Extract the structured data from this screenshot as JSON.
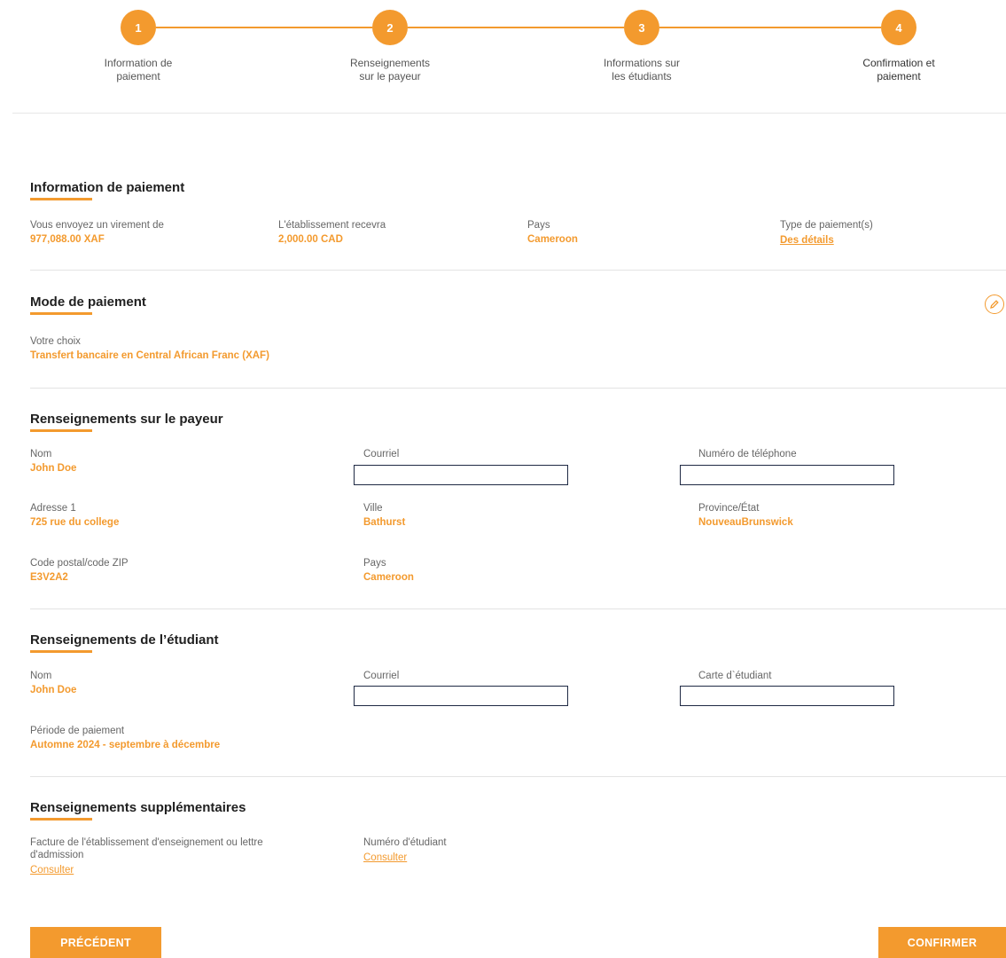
{
  "stepper": {
    "steps": [
      {
        "number": "1",
        "label_line1": "Information de",
        "label_line2": "paiement"
      },
      {
        "number": "2",
        "label_line1": "Renseignements",
        "label_line2": "sur le payeur"
      },
      {
        "number": "3",
        "label_line1": "Informations sur",
        "label_line2": "les étudiants"
      },
      {
        "number": "4",
        "label_line1": "Confirmation et",
        "label_line2": "paiement"
      }
    ],
    "active_step": 4
  },
  "payment_info": {
    "title": "Information de paiement",
    "sending_label": "Vous envoyez un virement de",
    "sending_value": "977,088.00 XAF",
    "receiving_label": "L'établissement recevra",
    "receiving_value": "2,000.00 CAD",
    "country_label": "Pays",
    "country_value": "Cameroon",
    "type_label": "Type de paiement(s)",
    "type_link": "Des détails"
  },
  "payment_mode": {
    "title": "Mode de paiement",
    "choice_label": "Votre choix",
    "choice_value": "Transfert bancaire en Central African Franc (XAF)",
    "edit_icon": "pencil-icon"
  },
  "payer_info": {
    "title": "Renseignements sur le payeur",
    "name_label": "Nom",
    "name_value": "John Doe",
    "email_label": "Courriel",
    "email_value": "",
    "phone_label": "Numéro de téléphone",
    "phone_value": "",
    "address_label": "Adresse 1",
    "address_value": "725 rue du college",
    "city_label": "Ville",
    "city_value": "Bathurst",
    "province_label": "Province/État",
    "province_value": "NouveauBrunswick",
    "postal_label": "Code postal/code ZIP",
    "postal_value": "E3V2A2",
    "country_label": "Pays",
    "country_value": "Cameroon"
  },
  "student_info": {
    "title": "Renseignements de l’étudiant",
    "name_label": "Nom",
    "name_value": "John Doe",
    "email_label": "Courriel",
    "email_value": "",
    "card_label": "Carte d`étudiant",
    "card_value": "",
    "period_label": "Période de paiement",
    "period_value": "Automne 2024 - septembre à décembre"
  },
  "additional_info": {
    "title": "Renseignements supplémentaires",
    "invoice_label_line1": "Facture de l'établissement d'enseignement ou lettre",
    "invoice_label_line2": "d'admission",
    "invoice_link": "Consulter",
    "student_number_label": "Numéro d'étudiant",
    "student_number_link": "Consulter"
  },
  "actions": {
    "previous_label": "PRÉCÉDENT",
    "confirm_label": "CONFIRMER"
  },
  "colors": {
    "accent": "#f39a2e",
    "input_border": "#1f2a44"
  }
}
